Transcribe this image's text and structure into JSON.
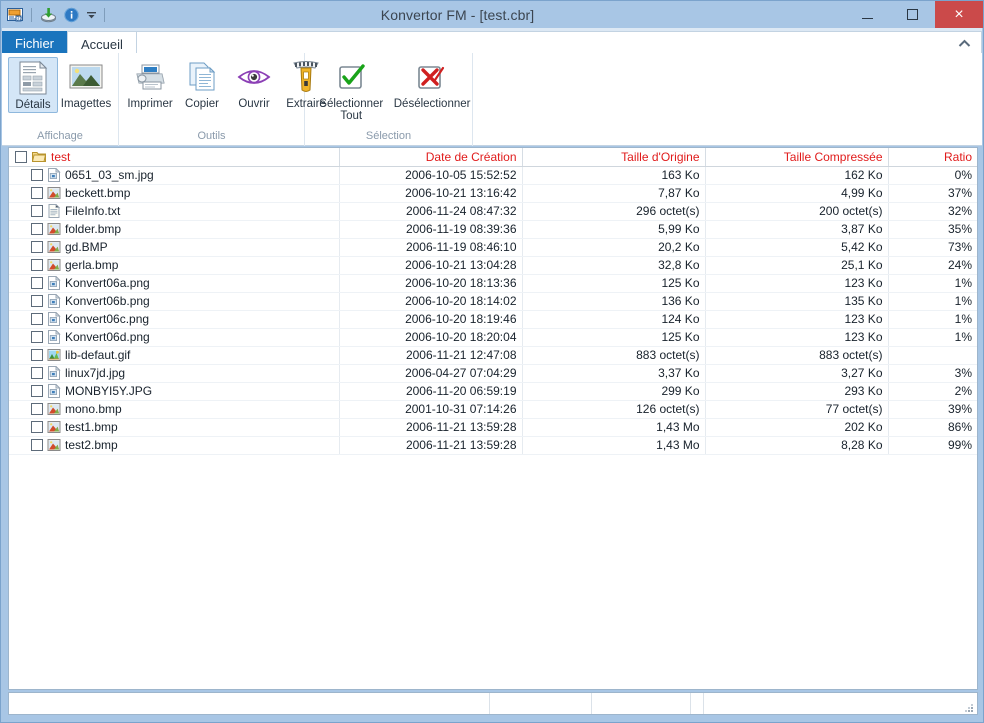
{
  "window": {
    "title": "Konvertor FM - [test.cbr]",
    "controls": {
      "minimize": "–",
      "maximize": "☐",
      "close": "×"
    },
    "accent_blue": "#a8c6e5",
    "close_red": "#cb4a4a"
  },
  "quick_access": {
    "items": [
      {
        "name": "app-icon",
        "tooltip": "Konvertor FM"
      },
      {
        "name": "save-icon",
        "tooltip": "Enregistrer"
      },
      {
        "name": "info-icon",
        "tooltip": "Informations"
      },
      {
        "name": "customize-dropdown-icon",
        "tooltip": "Personnaliser"
      }
    ]
  },
  "ribbon": {
    "tabs": [
      {
        "label": "Fichier",
        "active": false,
        "style": "file"
      },
      {
        "label": "Accueil",
        "active": true,
        "style": "normal"
      }
    ],
    "collapse_icon": "⌃",
    "groups": [
      {
        "title": "Affichage",
        "buttons": [
          {
            "label": "Détails",
            "icon": "details-view-icon",
            "selected": true
          },
          {
            "label": "Imagettes",
            "icon": "thumbnails-view-icon",
            "selected": false
          }
        ]
      },
      {
        "title": "Outils",
        "buttons": [
          {
            "label": "Imprimer",
            "icon": "printer-icon",
            "selected": false
          },
          {
            "label": "Copier",
            "icon": "copy-icon",
            "selected": false
          },
          {
            "label": "Ouvrir",
            "icon": "eye-open-icon",
            "selected": false
          },
          {
            "label": "Extraire",
            "icon": "zip-extract-icon",
            "selected": false
          }
        ]
      },
      {
        "title": "Sélection",
        "buttons": [
          {
            "label": "Sélectionner Tout",
            "icon": "check-all-icon",
            "selected": false,
            "wrap": true
          },
          {
            "label": "Désélectionner",
            "icon": "uncheck-all-icon",
            "selected": false,
            "wrap": true
          }
        ]
      }
    ]
  },
  "filelist": {
    "header_color": "#e01b1b",
    "columns": [
      {
        "key": "name",
        "label": "test",
        "align": "left"
      },
      {
        "key": "date",
        "label": "Date de Création",
        "align": "right"
      },
      {
        "key": "orig",
        "label": "Taille d'Origine",
        "align": "right"
      },
      {
        "key": "comp",
        "label": "Taille Compressée",
        "align": "right"
      },
      {
        "key": "ratio",
        "label": "Ratio",
        "align": "right"
      }
    ],
    "root": {
      "name": "test",
      "icon": "folder-icon",
      "checked": false
    },
    "rows": [
      {
        "name": "0651_03_sm.jpg",
        "icon": "image-file-icon",
        "date": "2006-10-05 15:52:52",
        "orig": "163 Ko",
        "comp": "162 Ko",
        "ratio": "0%"
      },
      {
        "name": "beckett.bmp",
        "icon": "bitmap-file-icon",
        "date": "2006-10-21 13:16:42",
        "orig": "7,87 Ko",
        "comp": "4,99 Ko",
        "ratio": "37%"
      },
      {
        "name": "FileInfo.txt",
        "icon": "text-file-icon",
        "date": "2006-11-24 08:47:32",
        "orig": "296 octet(s)",
        "comp": "200 octet(s)",
        "ratio": "32%"
      },
      {
        "name": "folder.bmp",
        "icon": "bitmap-file-icon",
        "date": "2006-11-19 08:39:36",
        "orig": "5,99 Ko",
        "comp": "3,87 Ko",
        "ratio": "35%"
      },
      {
        "name": "gd.BMP",
        "icon": "bitmap-file-icon",
        "date": "2006-11-19 08:46:10",
        "orig": "20,2 Ko",
        "comp": "5,42 Ko",
        "ratio": "73%"
      },
      {
        "name": "gerla.bmp",
        "icon": "bitmap-file-icon",
        "date": "2006-10-21 13:04:28",
        "orig": "32,8 Ko",
        "comp": "25,1 Ko",
        "ratio": "24%"
      },
      {
        "name": "Konvert06a.png",
        "icon": "image-file-icon",
        "date": "2006-10-20 18:13:36",
        "orig": "125 Ko",
        "comp": "123 Ko",
        "ratio": "1%"
      },
      {
        "name": "Konvert06b.png",
        "icon": "image-file-icon",
        "date": "2006-10-20 18:14:02",
        "orig": "136 Ko",
        "comp": "135 Ko",
        "ratio": "1%"
      },
      {
        "name": "Konvert06c.png",
        "icon": "image-file-icon",
        "date": "2006-10-20 18:19:46",
        "orig": "124 Ko",
        "comp": "123 Ko",
        "ratio": "1%"
      },
      {
        "name": "Konvert06d.png",
        "icon": "image-file-icon",
        "date": "2006-10-20 18:20:04",
        "orig": "125 Ko",
        "comp": "123 Ko",
        "ratio": "1%"
      },
      {
        "name": "lib-defaut.gif",
        "icon": "gif-file-icon",
        "date": "2006-11-21 12:47:08",
        "orig": "883 octet(s)",
        "comp": "883 octet(s)",
        "ratio": ""
      },
      {
        "name": "linux7jd.jpg",
        "icon": "image-file-icon",
        "date": "2006-04-27 07:04:29",
        "orig": "3,37 Ko",
        "comp": "3,27 Ko",
        "ratio": "3%"
      },
      {
        "name": "MONBYI5Y.JPG",
        "icon": "image-file-icon",
        "date": "2006-11-20 06:59:19",
        "orig": "299 Ko",
        "comp": "293 Ko",
        "ratio": "2%"
      },
      {
        "name": "mono.bmp",
        "icon": "bitmap-file-icon",
        "date": "2001-10-31 07:14:26",
        "orig": "126 octet(s)",
        "comp": "77 octet(s)",
        "ratio": "39%"
      },
      {
        "name": "test1.bmp",
        "icon": "bitmap-file-icon",
        "date": "2006-11-21 13:59:28",
        "orig": "1,43 Mo",
        "comp": "202 Ko",
        "ratio": "86%"
      },
      {
        "name": "test2.bmp",
        "icon": "bitmap-file-icon",
        "date": "2006-11-21 13:59:28",
        "orig": "1,43 Mo",
        "comp": "8,28 Ko",
        "ratio": "99%"
      }
    ]
  },
  "statusbar": {
    "panes": [
      "",
      "",
      "",
      ""
    ],
    "grip_icon": "resize-grip-icon"
  }
}
